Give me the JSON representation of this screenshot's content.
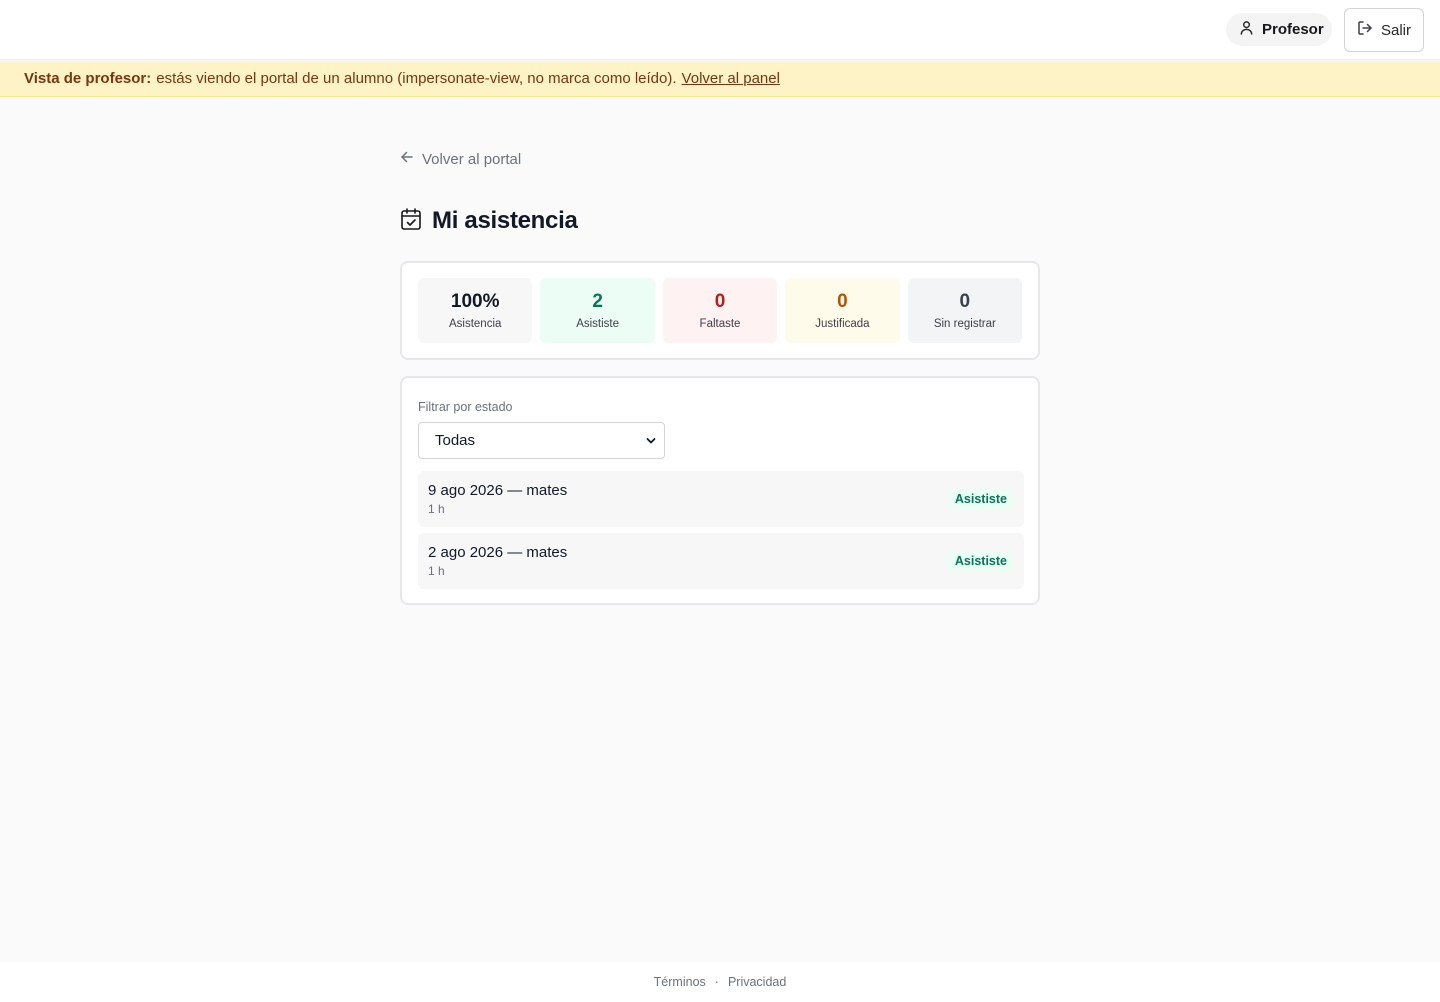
{
  "header": {
    "user_label": "Profesor",
    "logout_label": "Salir"
  },
  "banner": {
    "strong": "Vista de profesor:",
    "text": "estás viendo el portal de un alumno (impersonate-view, no marca como leído).",
    "link": "Volver al panel"
  },
  "nav": {
    "back_label": "Volver al portal"
  },
  "page": {
    "title": "Mi asistencia"
  },
  "stats": [
    {
      "value": "100%",
      "label": "Asistencia",
      "tone": "neutral"
    },
    {
      "value": "2",
      "label": "Asististe",
      "tone": "green"
    },
    {
      "value": "0",
      "label": "Faltaste",
      "tone": "red"
    },
    {
      "value": "0",
      "label": "Justificada",
      "tone": "amber"
    },
    {
      "value": "0",
      "label": "Sin registrar",
      "tone": "grey"
    }
  ],
  "filter": {
    "label": "Filtrar por estado",
    "selected": "Todas"
  },
  "sessions": [
    {
      "title": "9 ago 2026 — mates",
      "duration": "1 h",
      "status": "Asististe"
    },
    {
      "title": "2 ago 2026 — mates",
      "duration": "1 h",
      "status": "Asististe"
    }
  ],
  "footer": {
    "terms": "Términos",
    "separator": "·",
    "privacy": "Privacidad"
  },
  "colors": {
    "banner_bg": "#fef3c7",
    "banner_text": "#78350f",
    "present_green": "#047857",
    "absent_red": "#b91c1c",
    "justified_amber": "#b45309"
  }
}
